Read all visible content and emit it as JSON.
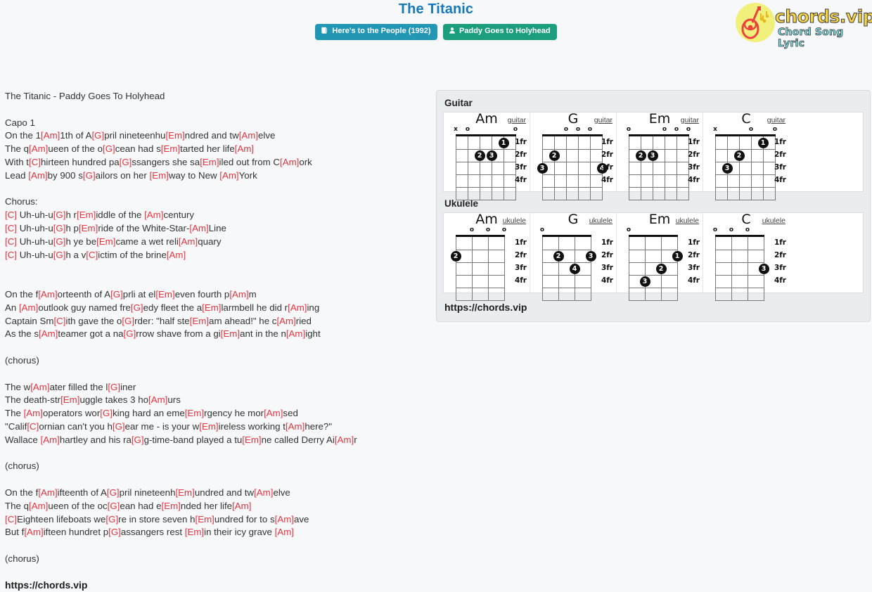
{
  "header": {
    "title": "The Titanic",
    "badges": [
      {
        "icon": "album-icon",
        "label": "Here's to the People (1992)",
        "kind": "album"
      },
      {
        "icon": "person-icon",
        "label": "Paddy Goes to Holyhead",
        "kind": "artist"
      }
    ],
    "logo": {
      "name": "chords.vip",
      "tagline": "Chord Song Lyric",
      "icon": "guitar-icon"
    }
  },
  "lyrics": {
    "lines": [
      [
        {
          "t": "The Titanic - Paddy Goes To Holyhead"
        }
      ],
      [],
      [
        {
          "t": "Capo 1"
        }
      ],
      [
        {
          "t": "On the 1"
        },
        {
          "c": "[Am]"
        },
        {
          "t": "1th of A"
        },
        {
          "c": "[G]"
        },
        {
          "t": "pril nineteenhu"
        },
        {
          "c": "[Em]"
        },
        {
          "t": "ndred and tw"
        },
        {
          "c": "[Am]"
        },
        {
          "t": "elve"
        }
      ],
      [
        {
          "t": "The q"
        },
        {
          "c": "[Am]"
        },
        {
          "t": "ueen of the o"
        },
        {
          "c": "[G]"
        },
        {
          "t": "cean had s"
        },
        {
          "c": "[Em]"
        },
        {
          "t": "tarted her life"
        },
        {
          "c": "[Am]"
        }
      ],
      [
        {
          "t": "With t"
        },
        {
          "c": "[C]"
        },
        {
          "t": "hirteen hundred pa"
        },
        {
          "c": "[G]"
        },
        {
          "t": "ssangers she sa"
        },
        {
          "c": "[Em]"
        },
        {
          "t": "iled out from C"
        },
        {
          "c": "[Am]"
        },
        {
          "t": "ork"
        }
      ],
      [
        {
          "t": "Lead "
        },
        {
          "c": "[Am]"
        },
        {
          "t": "by 900 s"
        },
        {
          "c": "[G]"
        },
        {
          "t": "ailors on her "
        },
        {
          "c": "[Em]"
        },
        {
          "t": "way to New "
        },
        {
          "c": "[Am]"
        },
        {
          "t": "York"
        }
      ],
      [],
      [
        {
          "t": "Chorus:"
        }
      ],
      [
        {
          "c": "[C]"
        },
        {
          "t": " Uh-uh-u"
        },
        {
          "c": "[G]"
        },
        {
          "t": "h r"
        },
        {
          "c": "[Em]"
        },
        {
          "t": "iddle of the "
        },
        {
          "c": "[Am]"
        },
        {
          "t": "century"
        }
      ],
      [
        {
          "c": "[C]"
        },
        {
          "t": " Uh-uh-u"
        },
        {
          "c": "[G]"
        },
        {
          "t": "h p"
        },
        {
          "c": "[Em]"
        },
        {
          "t": "ride of the White-Star-"
        },
        {
          "c": "[Am]"
        },
        {
          "t": "Line"
        }
      ],
      [
        {
          "c": "[C]"
        },
        {
          "t": " Uh-uh-u"
        },
        {
          "c": "[G]"
        },
        {
          "t": "h ye be"
        },
        {
          "c": "[Em]"
        },
        {
          "t": "came a wet reli"
        },
        {
          "c": "[Am]"
        },
        {
          "t": "quary"
        }
      ],
      [
        {
          "c": "[C]"
        },
        {
          "t": " Uh-uh-u"
        },
        {
          "c": "[G]"
        },
        {
          "t": "h a v"
        },
        {
          "c": "[C]"
        },
        {
          "t": "ictim of the brine"
        },
        {
          "c": "[Am]"
        }
      ],
      [],
      [],
      [
        {
          "t": "On the f"
        },
        {
          "c": "[Am]"
        },
        {
          "t": "orteenth of A"
        },
        {
          "c": "[G]"
        },
        {
          "t": "prli at el"
        },
        {
          "c": "[Em]"
        },
        {
          "t": "even fourth p"
        },
        {
          "c": "[Am]"
        },
        {
          "t": "m"
        }
      ],
      [
        {
          "t": "An "
        },
        {
          "c": "[Am]"
        },
        {
          "t": "outlook guy named fre"
        },
        {
          "c": "[G]"
        },
        {
          "t": "edy fleet the a"
        },
        {
          "c": "[Em]"
        },
        {
          "t": "larmbell he did r"
        },
        {
          "c": "[Am]"
        },
        {
          "t": "ing"
        }
      ],
      [
        {
          "t": "Captain Sm"
        },
        {
          "c": "[C]"
        },
        {
          "t": "ith gave the o"
        },
        {
          "c": "[G]"
        },
        {
          "t": "rder: \"half ste"
        },
        {
          "c": "[Em]"
        },
        {
          "t": "am ahead!\" he c"
        },
        {
          "c": "[Am]"
        },
        {
          "t": "ried"
        }
      ],
      [
        {
          "t": "As the s"
        },
        {
          "c": "[Am]"
        },
        {
          "t": "teamer got a na"
        },
        {
          "c": "[G]"
        },
        {
          "t": "rrow shave from a gi"
        },
        {
          "c": "[Em]"
        },
        {
          "t": "ant in the n"
        },
        {
          "c": "[Am]"
        },
        {
          "t": "ight"
        }
      ],
      [],
      [
        {
          "t": "(chorus)"
        }
      ],
      [],
      [
        {
          "t": "The w"
        },
        {
          "c": "[Am]"
        },
        {
          "t": "ater filled the l"
        },
        {
          "c": "[G]"
        },
        {
          "t": "iner"
        }
      ],
      [
        {
          "t": "The death-str"
        },
        {
          "c": "[Em]"
        },
        {
          "t": "uggle takes 3 ho"
        },
        {
          "c": "[Am]"
        },
        {
          "t": "urs"
        }
      ],
      [
        {
          "t": "The "
        },
        {
          "c": "[Am]"
        },
        {
          "t": "operators wor"
        },
        {
          "c": "[G]"
        },
        {
          "t": "king hard an eme"
        },
        {
          "c": "[Em]"
        },
        {
          "t": "rgency he mor"
        },
        {
          "c": "[Am]"
        },
        {
          "t": "sed"
        }
      ],
      [
        {
          "t": "\"Calif"
        },
        {
          "c": "[C]"
        },
        {
          "t": "ornian can't you h"
        },
        {
          "c": "[G]"
        },
        {
          "t": "ear me - is your w"
        },
        {
          "c": "[Em]"
        },
        {
          "t": "ireless working t"
        },
        {
          "c": "[Am]"
        },
        {
          "t": "here?\""
        }
      ],
      [
        {
          "t": "Wallace "
        },
        {
          "c": "[Am]"
        },
        {
          "t": "hartley and his ra"
        },
        {
          "c": "[G]"
        },
        {
          "t": "g-time-band played a tu"
        },
        {
          "c": "[Em]"
        },
        {
          "t": "ne called Derry Ai"
        },
        {
          "c": "[Am]"
        },
        {
          "t": "r"
        }
      ],
      [],
      [
        {
          "t": "(chorus)"
        }
      ],
      [],
      [
        {
          "t": "On the f"
        },
        {
          "c": "[Am]"
        },
        {
          "t": "ifteenth of A"
        },
        {
          "c": "[G]"
        },
        {
          "t": "pril nineteenh"
        },
        {
          "c": "[Em]"
        },
        {
          "t": "undred and tw"
        },
        {
          "c": "[Am]"
        },
        {
          "t": "elve"
        }
      ],
      [
        {
          "t": "The q"
        },
        {
          "c": "[Am]"
        },
        {
          "t": "ueen of the oc"
        },
        {
          "c": "[G]"
        },
        {
          "t": "ean had e"
        },
        {
          "c": "[Em]"
        },
        {
          "t": "nded her life"
        },
        {
          "c": "[Am]"
        }
      ],
      [
        {
          "c": "[C]"
        },
        {
          "t": "Eighteen lifeboats we"
        },
        {
          "c": "[G]"
        },
        {
          "t": "re in store seven h"
        },
        {
          "c": "[Em]"
        },
        {
          "t": "undred for to s"
        },
        {
          "c": "[Am]"
        },
        {
          "t": "ave"
        }
      ],
      [
        {
          "t": "But f"
        },
        {
          "c": "[Am]"
        },
        {
          "t": "ifteen hundret p"
        },
        {
          "c": "[G]"
        },
        {
          "t": "assangers rest "
        },
        {
          "c": "[Em]"
        },
        {
          "t": "in their icy grave "
        },
        {
          "c": "[Am]"
        }
      ],
      [],
      [
        {
          "t": "(chorus)"
        }
      ],
      []
    ],
    "footer_link": "https://chords.vip"
  },
  "chords_panel": {
    "guitar_heading": "Guitar",
    "ukulele_heading": "Ukulele",
    "fret_labels": [
      "1fr",
      "2fr",
      "3fr",
      "4fr"
    ],
    "link": "https://chords.vip",
    "guitar": [
      {
        "name": "Am",
        "type": "guitar",
        "strings": 6,
        "open": [
          "x",
          "o",
          "",
          "",
          "",
          "o"
        ],
        "dots": [
          {
            "string": 5,
            "fret": 1,
            "finger": "1"
          },
          {
            "string": 3,
            "fret": 2,
            "finger": "2"
          },
          {
            "string": 4,
            "fret": 2,
            "finger": "3"
          }
        ]
      },
      {
        "name": "G",
        "type": "guitar",
        "strings": 6,
        "open": [
          "",
          "",
          "o",
          "o",
          "o",
          ""
        ],
        "dots": [
          {
            "string": 2,
            "fret": 2,
            "finger": "2"
          },
          {
            "string": 1,
            "fret": 3,
            "finger": "3"
          },
          {
            "string": 6,
            "fret": 3,
            "finger": "4"
          }
        ]
      },
      {
        "name": "Em",
        "type": "guitar",
        "strings": 6,
        "open": [
          "o",
          "",
          "",
          "o",
          "o",
          "o"
        ],
        "dots": [
          {
            "string": 2,
            "fret": 2,
            "finger": "2"
          },
          {
            "string": 3,
            "fret": 2,
            "finger": "3"
          }
        ]
      },
      {
        "name": "C",
        "type": "guitar",
        "strings": 6,
        "open": [
          "x",
          "",
          "",
          "o",
          "",
          "o"
        ],
        "dots": [
          {
            "string": 5,
            "fret": 1,
            "finger": "1"
          },
          {
            "string": 3,
            "fret": 2,
            "finger": "2"
          },
          {
            "string": 2,
            "fret": 3,
            "finger": "3"
          }
        ]
      }
    ],
    "ukulele": [
      {
        "name": "Am",
        "type": "ukulele",
        "strings": 4,
        "open": [
          "",
          "o",
          "o",
          "o"
        ],
        "dots": [
          {
            "string": 1,
            "fret": 2,
            "finger": "2"
          }
        ]
      },
      {
        "name": "G",
        "type": "ukulele",
        "strings": 4,
        "open": [
          "o",
          "",
          "",
          ""
        ],
        "dots": [
          {
            "string": 2,
            "fret": 2,
            "finger": "2"
          },
          {
            "string": 4,
            "fret": 2,
            "finger": "3"
          },
          {
            "string": 3,
            "fret": 3,
            "finger": "4"
          }
        ]
      },
      {
        "name": "Em",
        "type": "ukulele",
        "strings": 4,
        "open": [
          "o",
          "",
          "",
          ""
        ],
        "dots": [
          {
            "string": 4,
            "fret": 2,
            "finger": "1"
          },
          {
            "string": 3,
            "fret": 3,
            "finger": "2"
          },
          {
            "string": 2,
            "fret": 4,
            "finger": "3"
          }
        ]
      },
      {
        "name": "C",
        "type": "ukulele",
        "strings": 4,
        "open": [
          "o",
          "o",
          "o",
          ""
        ],
        "dots": [
          {
            "string": 4,
            "fret": 3,
            "finger": "3"
          }
        ]
      }
    ]
  }
}
